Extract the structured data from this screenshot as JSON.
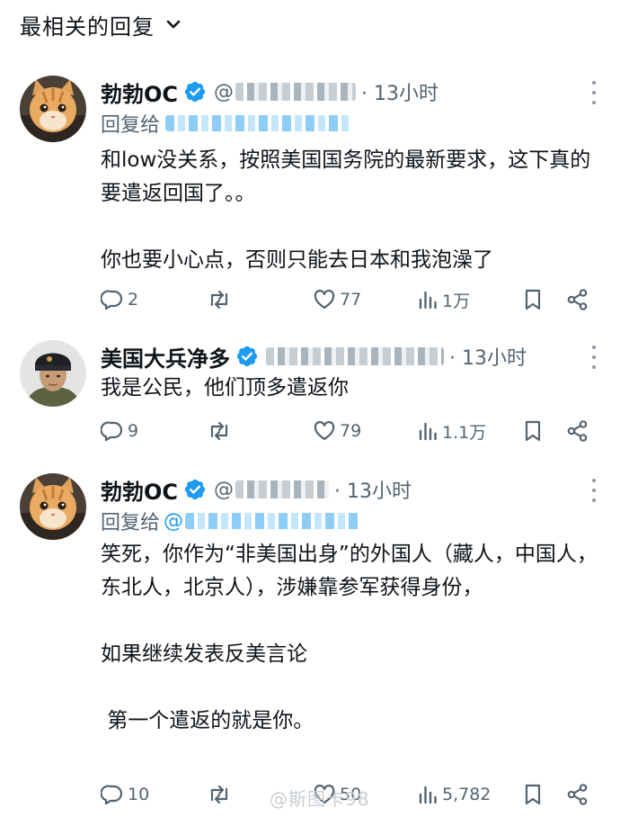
{
  "header": {
    "title": "最相关的回复"
  },
  "posts": [
    {
      "name": "勃勃OC",
      "handle_prefix": "@",
      "time": "· 13小时",
      "reply_prefix": "回复给",
      "reply_at": "",
      "paragraphs": [
        "和low没关系，按照美国国务院的最新要求，这下真的要遣返回国了。。",
        "",
        "你也要小心点，否则只能去日本和我泡澡了"
      ],
      "stats": {
        "replies": "2",
        "likes": "77",
        "views": "1万"
      }
    },
    {
      "name": "美国大兵净多",
      "handle_prefix": "",
      "time": "· 13小时",
      "reply_prefix": "",
      "reply_at": "",
      "paragraphs": [
        "我是公民，他们顶多遣返你"
      ],
      "stats": {
        "replies": "9",
        "likes": "79",
        "views": "1.1万"
      }
    },
    {
      "name": "勃勃OC",
      "handle_prefix": "@",
      "time": "· 13小时",
      "reply_prefix": "回复给",
      "reply_at": "@",
      "paragraphs": [
        "笑死，你作为“非美国出身”的外国人（藏人，中国人，东北人，北京人），涉嫌靠参军获得身份，",
        "",
        "如果继续发表反美言论",
        "",
        " 第一个遣返的就是你。"
      ],
      "stats": {
        "replies": "10",
        "likes": "50",
        "views": "5,782"
      }
    }
  ],
  "watermark": "@斯图卡98",
  "colors": {
    "verified": "#1d9bf0",
    "secondary": "#536471",
    "text": "#0f1419"
  },
  "icons": [
    "chevron-down-icon",
    "verified-badge-icon",
    "more-options-icon",
    "reply-icon",
    "repost-icon",
    "like-icon",
    "views-icon",
    "bookmark-icon",
    "share-icon"
  ]
}
